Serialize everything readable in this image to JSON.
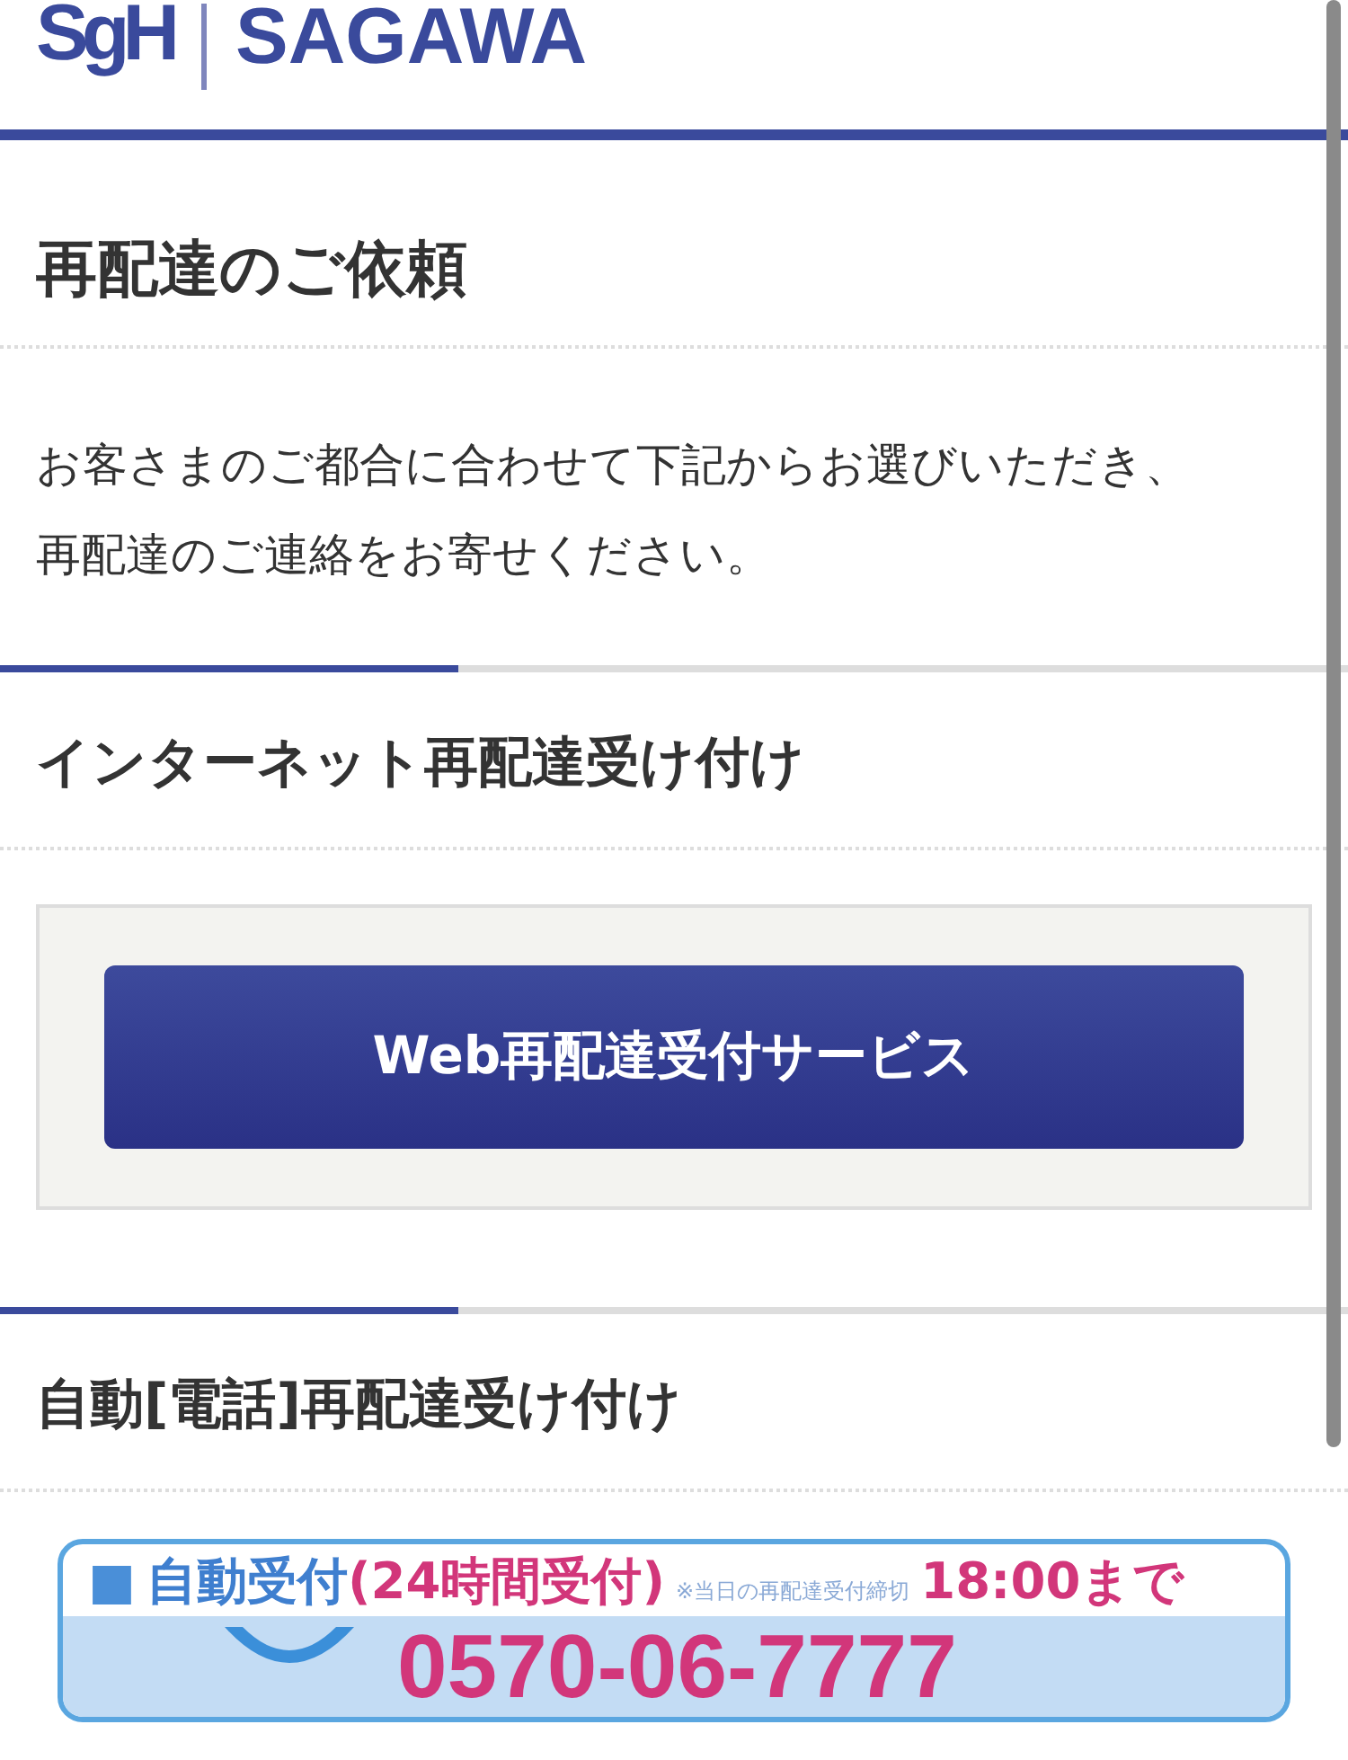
{
  "header": {
    "logo_mark": "SgH",
    "logo_text": "SAGAWA"
  },
  "title": "再配達のご依頼",
  "intro": [
    "お客さまのご都合に合わせて下記からお選びいただき、",
    "再配達のご連絡をお寄せください。"
  ],
  "sections": [
    {
      "heading": "インターネット再配達受け付け",
      "kind": "button",
      "button": "Web再配達受付サービス"
    },
    {
      "heading": "自動[電話]再配達受け付け",
      "kind": "banner",
      "banner": {
        "square": "■",
        "label": "自動受付",
        "hours": "(24時間受付)",
        "note": "※当日の再配達受付締切",
        "deadline": "18:00まで",
        "phone": "0570-06-7777"
      }
    }
  ]
}
